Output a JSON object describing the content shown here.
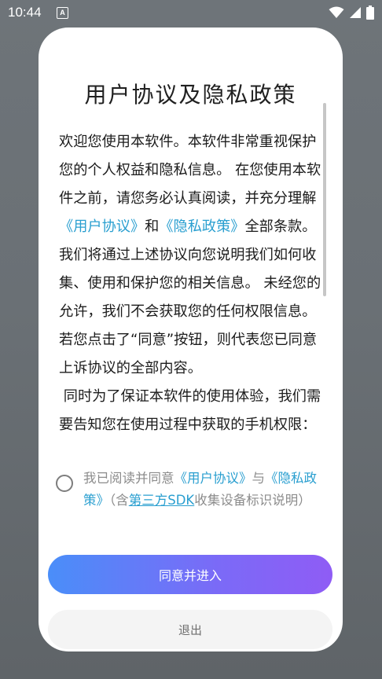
{
  "status_bar": {
    "time": "10:44",
    "notification_letter": "A"
  },
  "dialog": {
    "title": "用户协议及隐私政策",
    "body": {
      "p1_text1": "欢迎您使用本软件。本软件非常重视保护您的个人权益和隐私信息。 在您使用本软件之前，请您务必认真阅读，并充分理解",
      "p1_link1": "《用户协议》",
      "p1_and": "和",
      "p1_link2": "《隐私政策》",
      "p1_text2": "全部条款。 我们将通过上述协议向您说明我们如何收集、使用和保护您的相关信息。 未经您的允许，我们不会获取您的任何权限信息。若您点击了“同意”按钮，则代表您已同意上诉协议的全部内容。",
      "p2_text": " 同时为了保证本软件的使用体验，我们需要告知您在使用过程中获取的手机权限："
    },
    "agreement": {
      "text1": "我已阅读并同意",
      "link1": "《用户协议》",
      "text2": "与",
      "link2": "《隐私政策》",
      "text3": "（含",
      "link3": "第三方SDK",
      "text4": "收集设备标识说明）",
      "checked": false
    },
    "agree_button_label": "同意并进入",
    "exit_button_label": "退出"
  },
  "colors": {
    "link": "#2a9fd0",
    "button_gradient_start": "#4a8ef9",
    "button_gradient_end": "#8f5cf5"
  }
}
